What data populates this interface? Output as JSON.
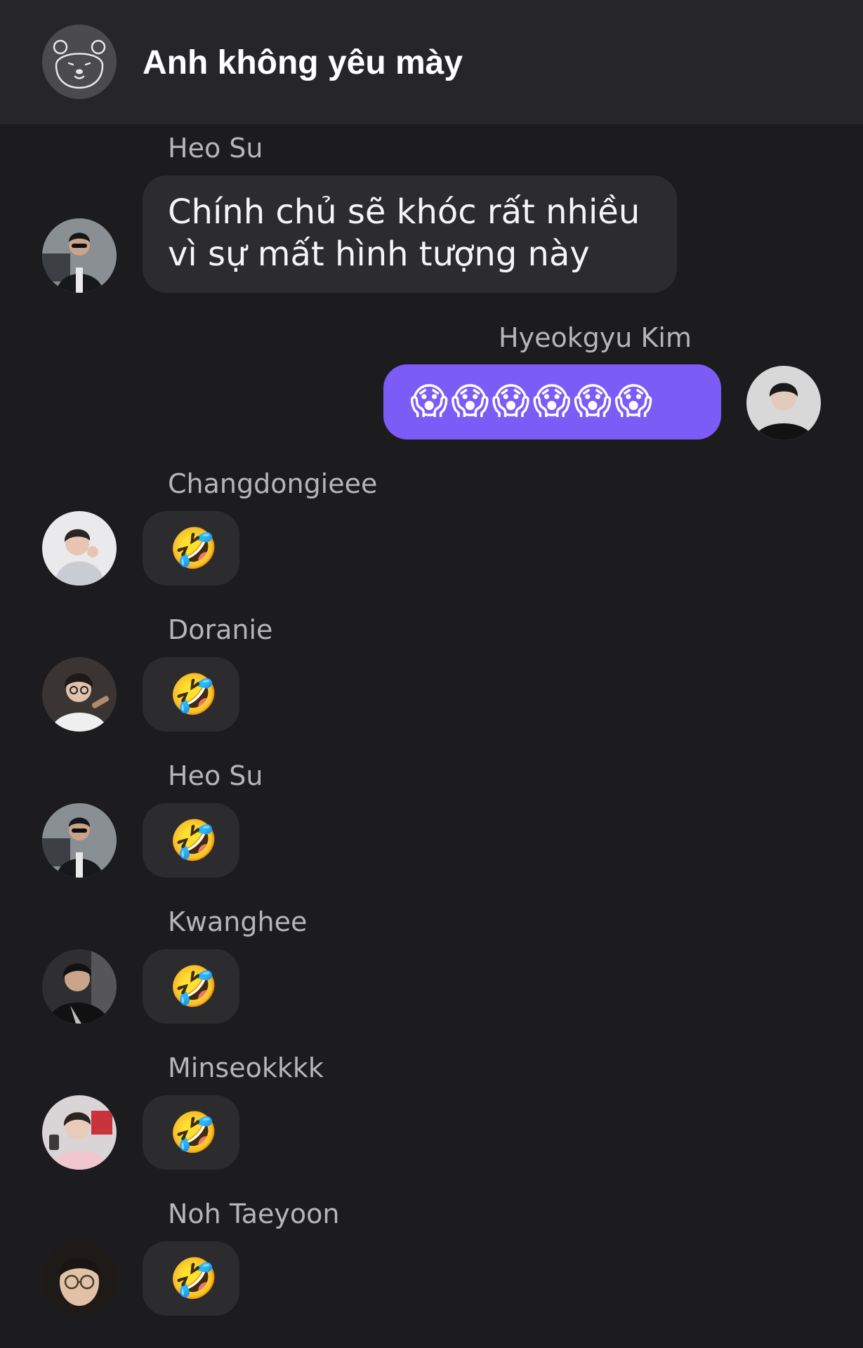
{
  "header": {
    "title": "Anh không yêu mày",
    "avatar_icon": "bear-face-icon"
  },
  "messages": [
    {
      "sender": "Heo Su",
      "text": "Chính chủ sẽ khóc rất nhiều vì sự mất hình tượng này",
      "mine": false,
      "avatar_icon": "person-photo-sunglasses"
    },
    {
      "sender": "Hyeokgyu Kim",
      "text": "😱😱😱😱😱😱",
      "mine": true,
      "avatar_icon": "person-photo-dark"
    },
    {
      "sender": "Changdongieee",
      "text": "🤣",
      "mine": false,
      "avatar_icon": "person-photo-hood"
    },
    {
      "sender": "Doranie",
      "text": "🤣",
      "mine": false,
      "avatar_icon": "person-photo-glasses"
    },
    {
      "sender": "Heo Su",
      "text": "🤣",
      "mine": false,
      "avatar_icon": "person-photo-sunglasses"
    },
    {
      "sender": "Kwanghee",
      "text": "🤣",
      "mine": false,
      "avatar_icon": "person-photo-jacket"
    },
    {
      "sender": "Minseokkkk",
      "text": "🤣",
      "mine": false,
      "avatar_icon": "person-photo-pink"
    },
    {
      "sender": "Noh Taeyoon",
      "text": "🤣",
      "mine": false,
      "avatar_icon": "person-photo-round-glasses"
    }
  ],
  "colors": {
    "background": "#1c1c1e",
    "header": "#262628",
    "bubble_other": "#2c2c2e",
    "bubble_mine": "#7c5cf6",
    "sender_name": "#b5b5ba"
  }
}
